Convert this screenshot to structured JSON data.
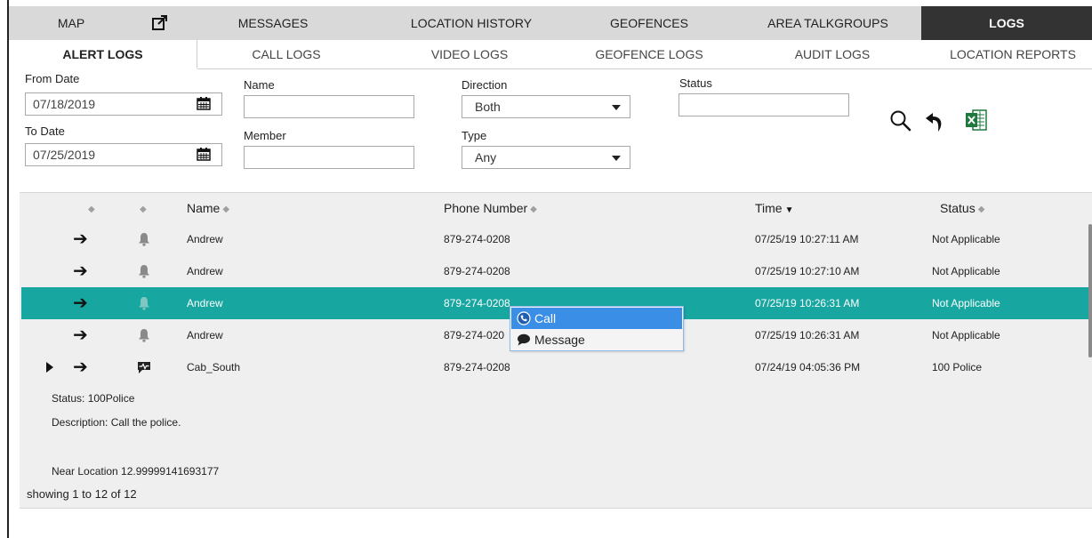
{
  "nav": {
    "tabs": [
      {
        "label": "MAP"
      },
      {
        "label": "MESSAGES"
      },
      {
        "label": "LOCATION HISTORY"
      },
      {
        "label": "GEOFENCES"
      },
      {
        "label": "AREA TALKGROUPS"
      },
      {
        "label": "LOGS",
        "active": true
      }
    ],
    "popout_icon": "popout-icon"
  },
  "subtabs": [
    {
      "label": "ALERT LOGS",
      "active": true
    },
    {
      "label": "CALL LOGS"
    },
    {
      "label": "VIDEO LOGS"
    },
    {
      "label": "GEOFENCE LOGS"
    },
    {
      "label": "AUDIT LOGS"
    },
    {
      "label": "LOCATION REPORTS"
    }
  ],
  "filters": {
    "from_date_label": "From Date",
    "from_date_value": "07/18/2019",
    "to_date_label": "To Date",
    "to_date_value": "07/25/2019",
    "name_label": "Name",
    "name_value": "",
    "member_label": "Member",
    "member_value": "",
    "direction_label": "Direction",
    "direction_value": "Both",
    "type_label": "Type",
    "type_value": "Any",
    "status_label": "Status",
    "status_value": ""
  },
  "tools": [
    "search-icon",
    "undo-icon",
    "excel-export-icon"
  ],
  "grid": {
    "columns": [
      "Name",
      "Phone Number",
      "Time",
      "Status"
    ],
    "rows": [
      {
        "name": "Andrew",
        "phone": "879-274-0208",
        "time": "07/25/19 10:27:11 AM",
        "status": "Not Applicable",
        "type_icon": "bell-icon"
      },
      {
        "name": "Andrew",
        "phone": "879-274-0208",
        "time": "07/25/19 10:27:10 AM",
        "status": "Not Applicable",
        "type_icon": "bell-icon"
      },
      {
        "name": "Andrew",
        "phone": "879-274-0208",
        "time": "07/25/19 10:26:31 AM",
        "status": "Not Applicable",
        "type_icon": "bell-icon",
        "selected": true
      },
      {
        "name": "Andrew",
        "phone": "879-274-020",
        "time": "07/25/19 10:26:31 AM",
        "status": "Not Applicable",
        "type_icon": "bell-icon"
      },
      {
        "name": "Cab_South",
        "phone": "879-274-0208",
        "time": "07/24/19 04:05:36 PM",
        "status": "100 Police",
        "type_icon": "heartbeat-chat-icon",
        "expandable": true
      }
    ],
    "detail": {
      "status": "Status: 100Police",
      "description": "Description: Call the police.",
      "location": "Near Location 12.99999141693177"
    },
    "showing": "showing 1 to 12 of 12"
  },
  "context_menu": {
    "items": [
      {
        "label": "Call",
        "icon": "call-icon"
      },
      {
        "label": "Message",
        "icon": "message-icon"
      }
    ]
  },
  "colors": {
    "selected_row": "#17a6a0",
    "active_nav": "#333333",
    "menu_highlight": "#3a8ee6"
  }
}
